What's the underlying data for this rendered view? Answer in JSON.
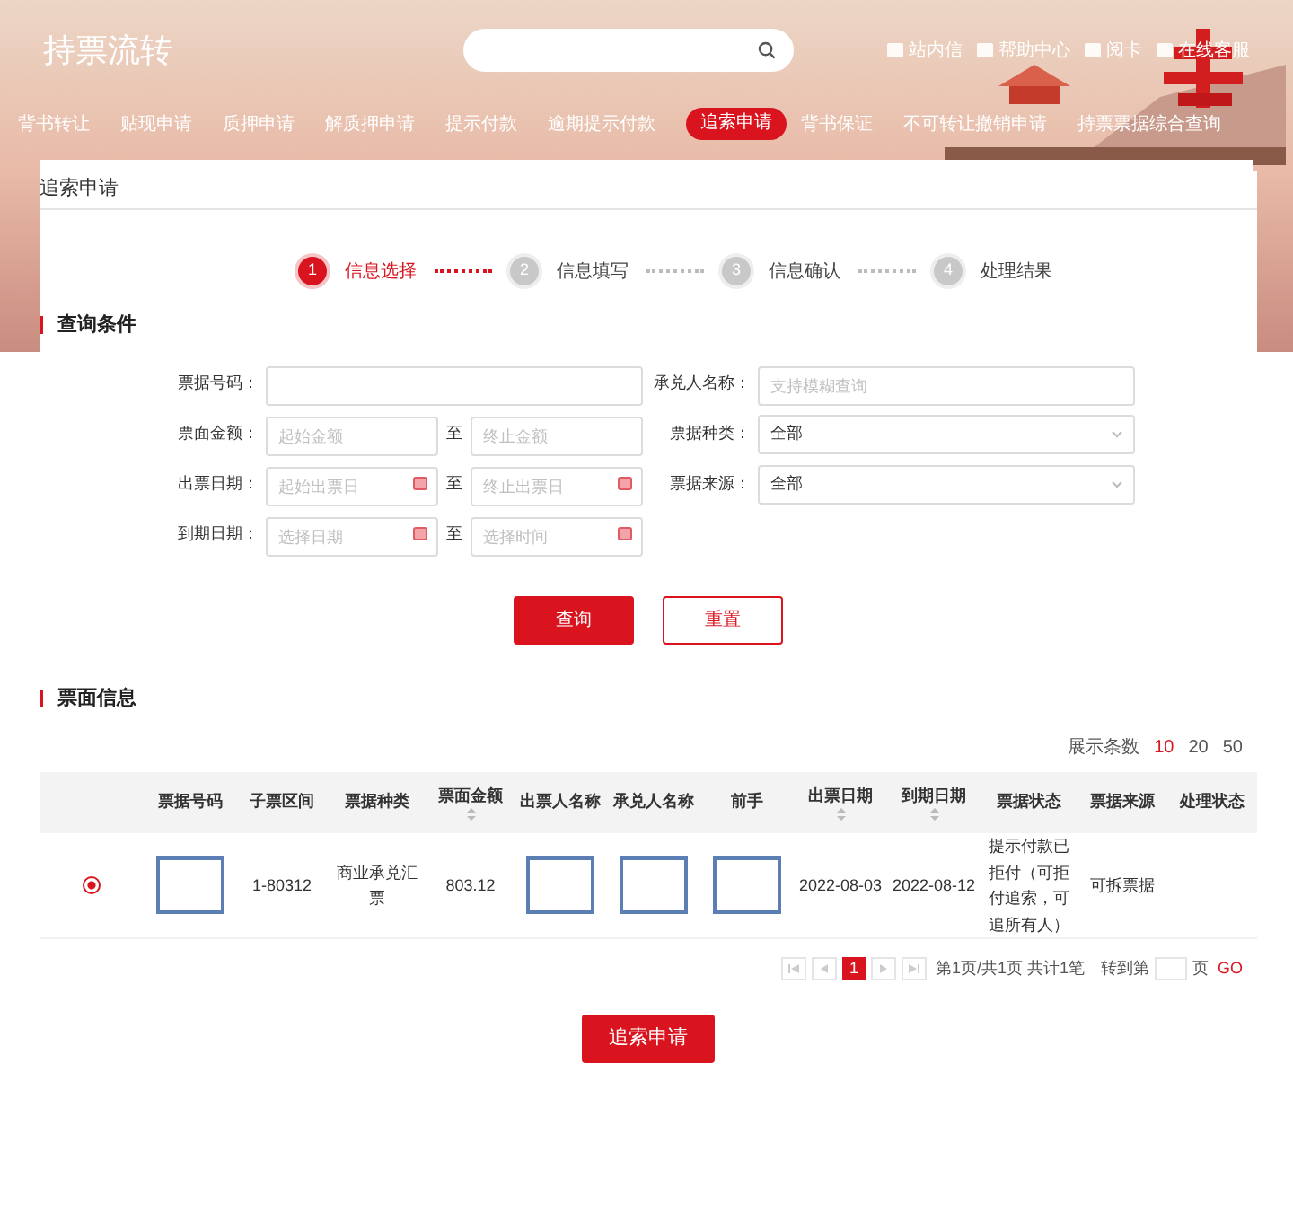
{
  "header": {
    "title": "持票流转",
    "links": [
      {
        "label": "站内信"
      },
      {
        "label": "帮助中心"
      },
      {
        "label": "阅卡"
      },
      {
        "label": "在线客服"
      }
    ]
  },
  "nav": [
    {
      "label": "背书转让",
      "selected": false
    },
    {
      "label": "贴现申请",
      "selected": false
    },
    {
      "label": "质押申请",
      "selected": false
    },
    {
      "label": "解质押申请",
      "selected": false
    },
    {
      "label": "提示付款",
      "selected": false
    },
    {
      "label": "逾期提示付款",
      "selected": false
    },
    {
      "label": "追索申请",
      "selected": true
    },
    {
      "label": "背书保证",
      "selected": false
    },
    {
      "label": "不可转让撤销申请",
      "selected": false
    },
    {
      "label": "持票票据综合查询",
      "selected": false
    }
  ],
  "page_title": "追索申请",
  "steps": [
    {
      "number": "1",
      "label": "信息选择",
      "selected": true
    },
    {
      "number": "2",
      "label": "信息填写",
      "selected": false
    },
    {
      "number": "3",
      "label": "信息确认",
      "selected": false
    },
    {
      "number": "4",
      "label": "处理结果",
      "selected": false
    }
  ],
  "query": {
    "title": "查询条件",
    "rows": [
      [
        {
          "label": "票据号码：",
          "kind": "text"
        },
        {
          "label": "承兑人名称：",
          "kind": "text",
          "placeholder": "支持模糊查询"
        }
      ],
      [
        {
          "label": "票面金额：",
          "kind": "range",
          "separator": "至",
          "from": {
            "placeholder": "起始金额"
          },
          "to": {
            "placeholder": "终止金额"
          }
        },
        {
          "label": "票据种类：",
          "kind": "select",
          "value": "全部"
        }
      ],
      [
        {
          "label": "出票日期：",
          "kind": "daterange",
          "separator": "至",
          "from": {
            "placeholder": "起始出票日"
          },
          "to": {
            "placeholder": "终止出票日"
          }
        },
        {
          "label": "票据来源：",
          "kind": "select",
          "value": "全部"
        }
      ],
      [
        {
          "label": "到期日期：",
          "kind": "daterange",
          "separator": "至",
          "from": {
            "placeholder": "选择日期"
          },
          "to": {
            "placeholder": "选择时间"
          }
        }
      ]
    ],
    "buttons": [
      {
        "label": "查询",
        "kind": "primary"
      },
      {
        "label": "重置",
        "kind": "outline"
      }
    ]
  },
  "results": {
    "title": "票面信息",
    "page_size_label": "展示条数",
    "page_sizes": [
      {
        "label": "10",
        "selected": true
      },
      {
        "label": "20",
        "selected": false
      },
      {
        "label": "50",
        "selected": false
      }
    ],
    "columns": [
      {
        "label": "票据号码",
        "sortable": false
      },
      {
        "label": "子票区间",
        "sortable": false
      },
      {
        "label": "票据种类",
        "sortable": false
      },
      {
        "label": "票面金额",
        "sortable": true
      },
      {
        "label": "出票人名称",
        "sortable": false
      },
      {
        "label": "承兑人名称",
        "sortable": false
      },
      {
        "label": "前手",
        "sortable": false
      },
      {
        "label": "出票日期",
        "sortable": true
      },
      {
        "label": "到期日期",
        "sortable": true
      },
      {
        "label": "票据状态",
        "sortable": false
      },
      {
        "label": "票据来源",
        "sortable": false
      },
      {
        "label": "处理状态",
        "sortable": false
      }
    ],
    "rows": [
      {
        "selected": true,
        "cells": [
          {
            "kind": "redacted"
          },
          {
            "text": "1-80312"
          },
          {
            "text": "商业承兑汇票"
          },
          {
            "text": "803.12"
          },
          {
            "kind": "redacted"
          },
          {
            "kind": "redacted"
          },
          {
            "kind": "redacted"
          },
          {
            "text": "2022-08-03"
          },
          {
            "text": "2022-08-12"
          },
          {
            "text": "提示付款已拒付（可拒付追索，可追所有人）"
          },
          {
            "text": "可拆票据"
          },
          {
            "kind": "empty"
          }
        ]
      }
    ],
    "pagination": {
      "pages": [
        {
          "label": "1",
          "selected": true
        }
      ],
      "summary": "第1页/共1页 共计1笔",
      "goto_label": "转到第",
      "page_unit": "页",
      "go": "GO"
    }
  },
  "submit": "追索申请"
}
